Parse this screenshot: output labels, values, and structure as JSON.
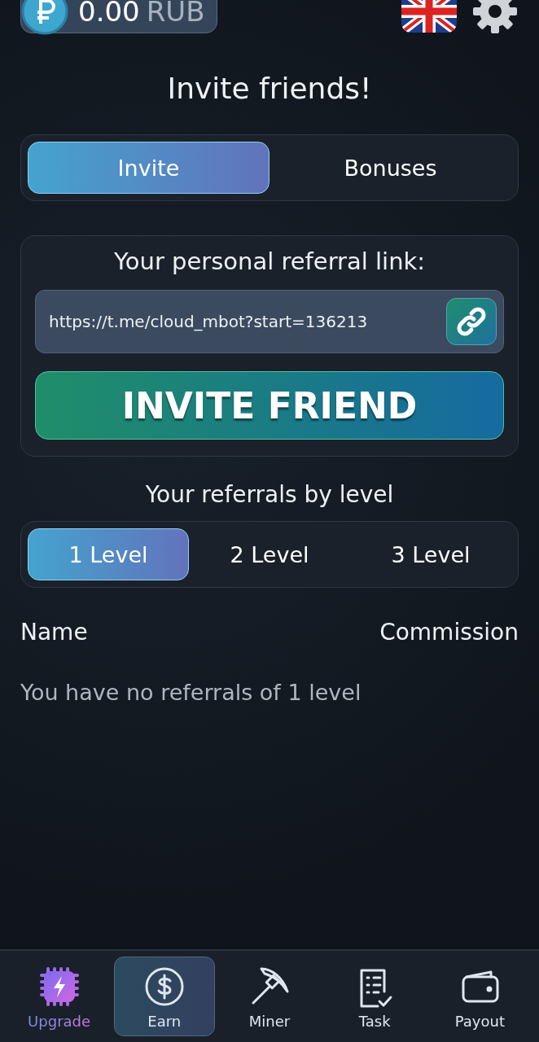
{
  "balance": {
    "amount": "0.00",
    "currency": "RUB"
  },
  "title": "Invite friends!",
  "tabs": [
    {
      "label": "Invite",
      "selected": true
    },
    {
      "label": "Bonuses",
      "selected": false
    }
  ],
  "referral": {
    "heading": "Your personal referral link:",
    "link": "https://t.me/cloud_mbot?start=136213",
    "button": "INVITE FRIEND"
  },
  "levels_heading": "Your referrals by level",
  "level_tabs": [
    {
      "label": "1 Level",
      "selected": true
    },
    {
      "label": "2 Level",
      "selected": false
    },
    {
      "label": "3 Level",
      "selected": false
    }
  ],
  "table": {
    "columns": [
      "Name",
      "Commission"
    ],
    "empty_message": "You have no referrals of 1 level"
  },
  "nav": [
    {
      "label": "Upgrade",
      "kind": "upgrade",
      "selected": false
    },
    {
      "label": "Earn",
      "kind": "earn",
      "selected": true
    },
    {
      "label": "Miner",
      "kind": "miner",
      "selected": false
    },
    {
      "label": "Task",
      "kind": "task",
      "selected": false
    },
    {
      "label": "Payout",
      "kind": "payout",
      "selected": false
    }
  ]
}
